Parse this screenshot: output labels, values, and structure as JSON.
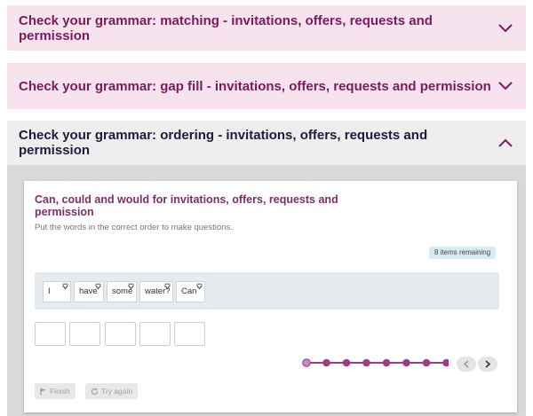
{
  "accordions": [
    {
      "title": "Check your grammar: matching - invitations, offers, requests and permission",
      "state": "collapsed"
    },
    {
      "title": "Check your grammar: gap fill - invitations, offers, requests and permission",
      "state": "collapsed"
    },
    {
      "title": "Check your grammar: ordering - invitations, offers, requests and permission",
      "state": "expanded"
    }
  ],
  "exercise": {
    "title": "Can, could and would for invitations, offers, requests and permission",
    "instruction": "Put the words in the correct order to make questions.",
    "remaining": "8 items remaining",
    "words": [
      "I",
      "have",
      "some",
      "water?",
      "Can"
    ],
    "slots_count": 5,
    "progress": {
      "total": 8,
      "current": 1
    },
    "finish_label": "Finish",
    "try_again_label": "Try again"
  },
  "colors": {
    "pink_header": "#f6e3ee",
    "pink_title": "#7b1a5e",
    "dark_title": "#23193d",
    "accent": "#9c3d86"
  },
  "icons": {
    "collapsed": "chevron-down-icon",
    "expanded": "chevron-up-icon",
    "word_handle": "drag-handle-icon",
    "prev": "chevron-left-icon",
    "next": "chevron-right-icon",
    "finish": "flag-icon",
    "try_again": "refresh-icon"
  }
}
